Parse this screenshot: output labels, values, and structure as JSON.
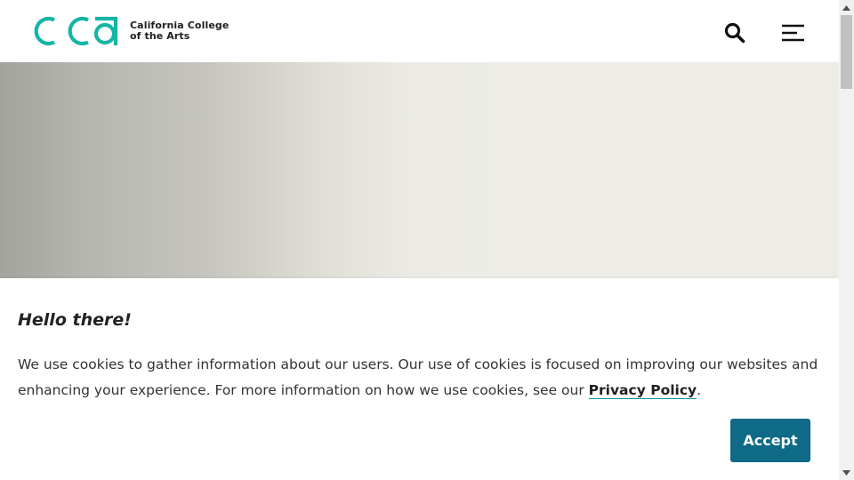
{
  "header": {
    "logo_mark": "cca",
    "logo_line1": "California College",
    "logo_line2": "of the Arts",
    "search_label": "Search",
    "menu_label": "Menu"
  },
  "cookie_banner": {
    "title": "Hello there!",
    "text_before_link": "We use cookies to gather information about our users. Our use of cookies is focused on improving our websites and enhancing your experience. For more information on how we use cookies, see our ",
    "link_text": "Privacy Policy",
    "text_after_link": ".",
    "accept_label": "Accept"
  },
  "colors": {
    "brand_teal": "#14b5a6",
    "accept_button": "#0e6a86",
    "link_underline": "#0a8fa8"
  },
  "icons": {
    "search": "search-icon",
    "menu": "hamburger-menu-icon",
    "scroll_up": "scroll-up-arrow-icon",
    "scroll_down": "scroll-down-arrow-icon"
  }
}
